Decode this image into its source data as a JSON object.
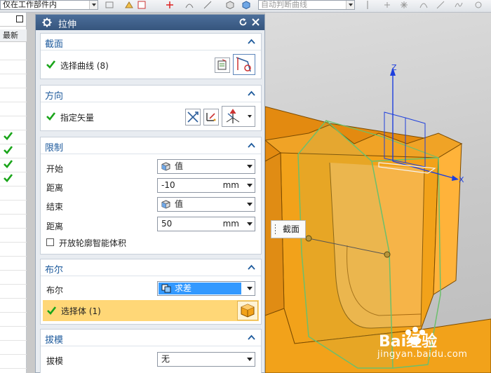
{
  "toolbar": {
    "scope_filter": "仅在工作部件内",
    "curve_rule": "自动判断曲线"
  },
  "navigator": {
    "column_header": "最新",
    "rows": [
      {
        "checked": false
      },
      {
        "checked": false
      },
      {
        "checked": false
      },
      {
        "checked": false
      },
      {
        "checked": false
      },
      {
        "checked": false
      },
      {
        "checked": true
      },
      {
        "checked": true
      },
      {
        "checked": true
      },
      {
        "checked": true
      },
      {
        "checked": false
      },
      {
        "checked": false
      },
      {
        "checked": false
      },
      {
        "checked": false
      },
      {
        "checked": false
      },
      {
        "checked": false
      },
      {
        "checked": false
      },
      {
        "checked": false
      },
      {
        "checked": false
      },
      {
        "checked": false
      },
      {
        "checked": false
      },
      {
        "checked": false
      },
      {
        "checked": false
      }
    ]
  },
  "dialog": {
    "title": "拉伸",
    "section_section": {
      "title": "截面",
      "select_curve_label": "选择曲线 (8)"
    },
    "section_direction": {
      "title": "方向",
      "specify_vector_label": "指定矢量"
    },
    "section_limits": {
      "title": "限制",
      "start_label": "开始",
      "start_option": "值",
      "start_distance_label": "距离",
      "start_distance_value": "-10",
      "start_distance_unit": "mm",
      "end_label": "结束",
      "end_option": "值",
      "end_distance_label": "距离",
      "end_distance_value": "50",
      "end_distance_unit": "mm",
      "open_profile_label": "开放轮廓智能体积",
      "open_profile_checked": false
    },
    "section_boolean": {
      "title": "布尔",
      "boolean_label": "布尔",
      "boolean_option": "求差",
      "select_body_label": "选择体 (1)"
    },
    "section_draft": {
      "title": "拔模",
      "draft_label": "拔模",
      "draft_option": "无"
    }
  },
  "viewport": {
    "axis_z": "Z",
    "axis_x": "X",
    "section_tag": "截面"
  },
  "watermark": {
    "brand": "Bai经验",
    "url": "jingyan.baidu.com"
  },
  "colors": {
    "title_bar": "#3f628f",
    "section_title": "#1d5a9c",
    "check_green": "#1aa51a",
    "selected_row": "#ffd777",
    "boolean_highlight": "#3399ff",
    "part_orange": "#f2a21a"
  }
}
